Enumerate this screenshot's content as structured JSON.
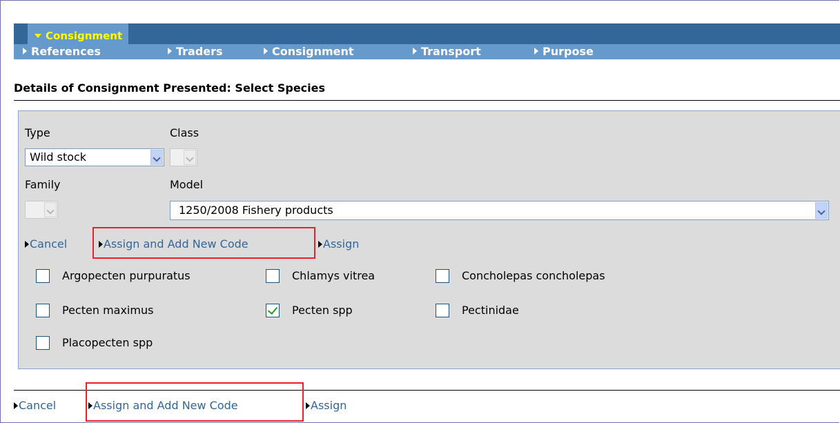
{
  "nav": {
    "active_tab": "Consignment",
    "sub_items": [
      "References",
      "Traders",
      "Consignment",
      "Transport",
      "Purpose"
    ]
  },
  "page_title": "Details of Consignment Presented: Select Species",
  "form": {
    "type_label": "Type",
    "type_value": "Wild stock",
    "class_label": "Class",
    "family_label": "Family",
    "model_label": "Model",
    "model_value": "1250/2008 Fishery products"
  },
  "actions": {
    "cancel": "Cancel",
    "assign_add": "Assign and Add New Code",
    "assign": "Assign"
  },
  "species": [
    {
      "label": "Argopecten purpuratus",
      "checked": false
    },
    {
      "label": "Chlamys vitrea",
      "checked": false
    },
    {
      "label": "Concholepas concholepas",
      "checked": false
    },
    {
      "label": "Pecten maximus",
      "checked": false
    },
    {
      "label": "Pecten spp",
      "checked": true
    },
    {
      "label": "Pectinidae",
      "checked": false
    },
    {
      "label": "Placopecten spp",
      "checked": false
    }
  ],
  "colors": {
    "nav_dark": "#336699",
    "nav_light": "#6699cc",
    "active_text": "#ffff00",
    "link": "#336699",
    "highlight_box": "#e8222a",
    "checkmark": "#21a121"
  }
}
